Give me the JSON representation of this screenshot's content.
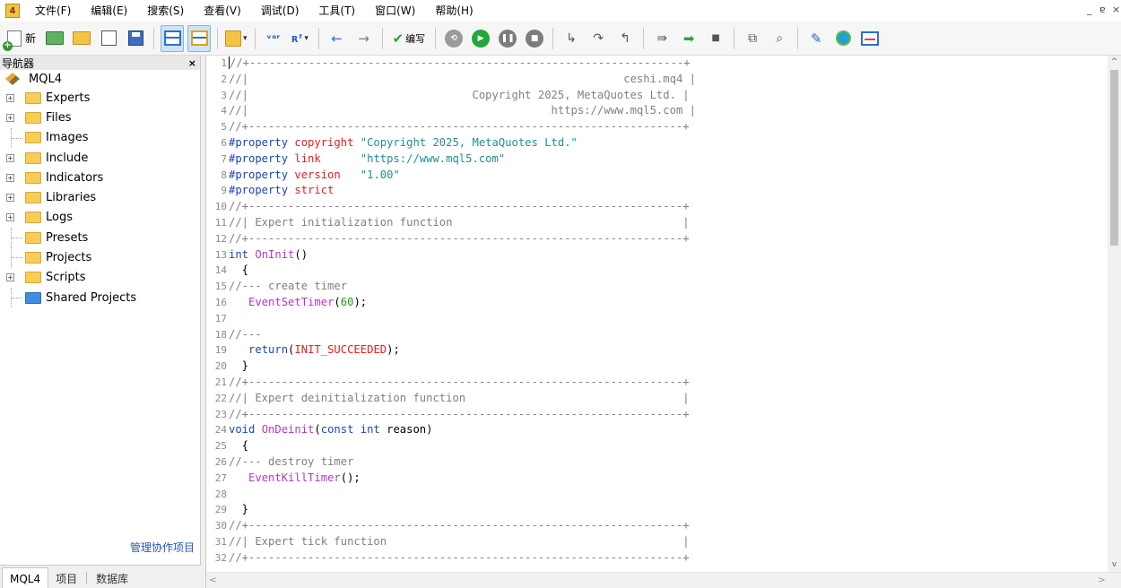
{
  "menubar": {
    "app_icon": "4",
    "items": [
      "文件(F)",
      "编辑(E)",
      "搜索(S)",
      "查看(V)",
      "调试(D)",
      "工具(T)",
      "窗口(W)",
      "帮助(H)"
    ],
    "window_controls": [
      "_",
      "ɐ",
      "×"
    ]
  },
  "toolbar": {
    "new_label": "新",
    "compile_label": "编写",
    "var_glyph": "ᵛᵃʳ",
    "func_glyph": "ʀᶠ"
  },
  "navigator": {
    "title": "导航器",
    "close": "×",
    "root": "MQL4",
    "items": [
      {
        "label": "Experts",
        "expandable": true,
        "color": "yellow"
      },
      {
        "label": "Files",
        "expandable": true,
        "color": "yellow"
      },
      {
        "label": "Images",
        "expandable": false,
        "color": "yellow"
      },
      {
        "label": "Include",
        "expandable": true,
        "color": "yellow"
      },
      {
        "label": "Indicators",
        "expandable": true,
        "color": "yellow"
      },
      {
        "label": "Libraries",
        "expandable": true,
        "color": "yellow"
      },
      {
        "label": "Logs",
        "expandable": true,
        "color": "yellow"
      },
      {
        "label": "Presets",
        "expandable": false,
        "color": "yellow"
      },
      {
        "label": "Projects",
        "expandable": false,
        "color": "yellow"
      },
      {
        "label": "Scripts",
        "expandable": true,
        "color": "yellow"
      },
      {
        "label": "Shared Projects",
        "expandable": false,
        "color": "blue"
      }
    ],
    "manage_link": "管理协作项目",
    "tabs": [
      "MQL4",
      "项目",
      "数据库"
    ]
  },
  "editor": {
    "line_numbers": [
      "1",
      "2",
      "3",
      "4",
      "5",
      "6",
      "7",
      "8",
      "9",
      "10",
      "11",
      "12",
      "13",
      "14",
      "15",
      "16",
      "17",
      "18",
      "19",
      "20",
      "21",
      "22",
      "23",
      "24",
      "25",
      "26",
      "27",
      "28",
      "29",
      "30",
      "31",
      "32"
    ],
    "lines": [
      [
        [
          "com",
          "//+------------------------------------------------------------------+"
        ]
      ],
      [
        [
          "com",
          "//|                                                         ceshi.mq4 |"
        ]
      ],
      [
        [
          "com",
          "//|                                  Copyright 2025, MetaQuotes Ltd. |"
        ]
      ],
      [
        [
          "com",
          "//|                                              https://www.mql5.com |"
        ]
      ],
      [
        [
          "com",
          "//+------------------------------------------------------------------+"
        ]
      ],
      [
        [
          "pp",
          "#property "
        ],
        [
          "prop",
          "copyright "
        ],
        [
          "str",
          "\"Copyright 2025, MetaQuotes Ltd.\""
        ]
      ],
      [
        [
          "pp",
          "#property "
        ],
        [
          "prop",
          "link      "
        ],
        [
          "str",
          "\"https://www.mql5.com\""
        ]
      ],
      [
        [
          "pp",
          "#property "
        ],
        [
          "prop",
          "version   "
        ],
        [
          "str",
          "\"1.00\""
        ]
      ],
      [
        [
          "pp",
          "#property "
        ],
        [
          "prop",
          "strict"
        ]
      ],
      [
        [
          "com",
          "//+------------------------------------------------------------------+"
        ]
      ],
      [
        [
          "com",
          "//| Expert initialization function                                   |"
        ]
      ],
      [
        [
          "com",
          "//+------------------------------------------------------------------+"
        ]
      ],
      [
        [
          "kw",
          "int "
        ],
        [
          "fn",
          "OnInit"
        ],
        [
          "pn",
          "()"
        ]
      ],
      [
        [
          "pn",
          "  {"
        ]
      ],
      [
        [
          "com",
          "//--- create timer"
        ]
      ],
      [
        [
          "pn",
          "   "
        ],
        [
          "fn",
          "EventSetTimer"
        ],
        [
          "pn",
          "("
        ],
        [
          "num",
          "60"
        ],
        [
          "pn",
          ");"
        ]
      ],
      [
        [
          "pn",
          ""
        ]
      ],
      [
        [
          "com",
          "//---"
        ]
      ],
      [
        [
          "pn",
          "   "
        ],
        [
          "kw",
          "return"
        ],
        [
          "pn",
          "("
        ],
        [
          "const",
          "INIT_SUCCEEDED"
        ],
        [
          "pn",
          ");"
        ]
      ],
      [
        [
          "pn",
          "  }"
        ]
      ],
      [
        [
          "com",
          "//+------------------------------------------------------------------+"
        ]
      ],
      [
        [
          "com",
          "//| Expert deinitialization function                                 |"
        ]
      ],
      [
        [
          "com",
          "//+------------------------------------------------------------------+"
        ]
      ],
      [
        [
          "kw",
          "void "
        ],
        [
          "fn",
          "OnDeinit"
        ],
        [
          "pn",
          "("
        ],
        [
          "kw",
          "const int "
        ],
        [
          "pn",
          "reason)"
        ]
      ],
      [
        [
          "pn",
          "  {"
        ]
      ],
      [
        [
          "com",
          "//--- destroy timer"
        ]
      ],
      [
        [
          "pn",
          "   "
        ],
        [
          "fn",
          "EventKillTimer"
        ],
        [
          "pn",
          "();"
        ]
      ],
      [
        [
          "pn",
          ""
        ]
      ],
      [
        [
          "pn",
          "  }"
        ]
      ],
      [
        [
          "com",
          "//+------------------------------------------------------------------+"
        ]
      ],
      [
        [
          "com",
          "//| Expert tick function                                             |"
        ]
      ],
      [
        [
          "com",
          "//+------------------------------------------------------------------+"
        ]
      ]
    ],
    "scroll_up": "^",
    "scroll_down": "v",
    "scroll_left": "<",
    "scroll_right": ">"
  },
  "icons": {
    "new": "new-file-icon",
    "template": "template-icon",
    "open": "folder-open-icon",
    "save": "save-icon",
    "save_all": "save-all-icon",
    "navigator": "navigator-panel-icon",
    "toolbox": "toolbox-panel-icon",
    "styler": "styler-icon",
    "compile": "compile-icon",
    "play": "start-debug-icon",
    "pause": "pause-icon",
    "stop": "stop-icon"
  }
}
